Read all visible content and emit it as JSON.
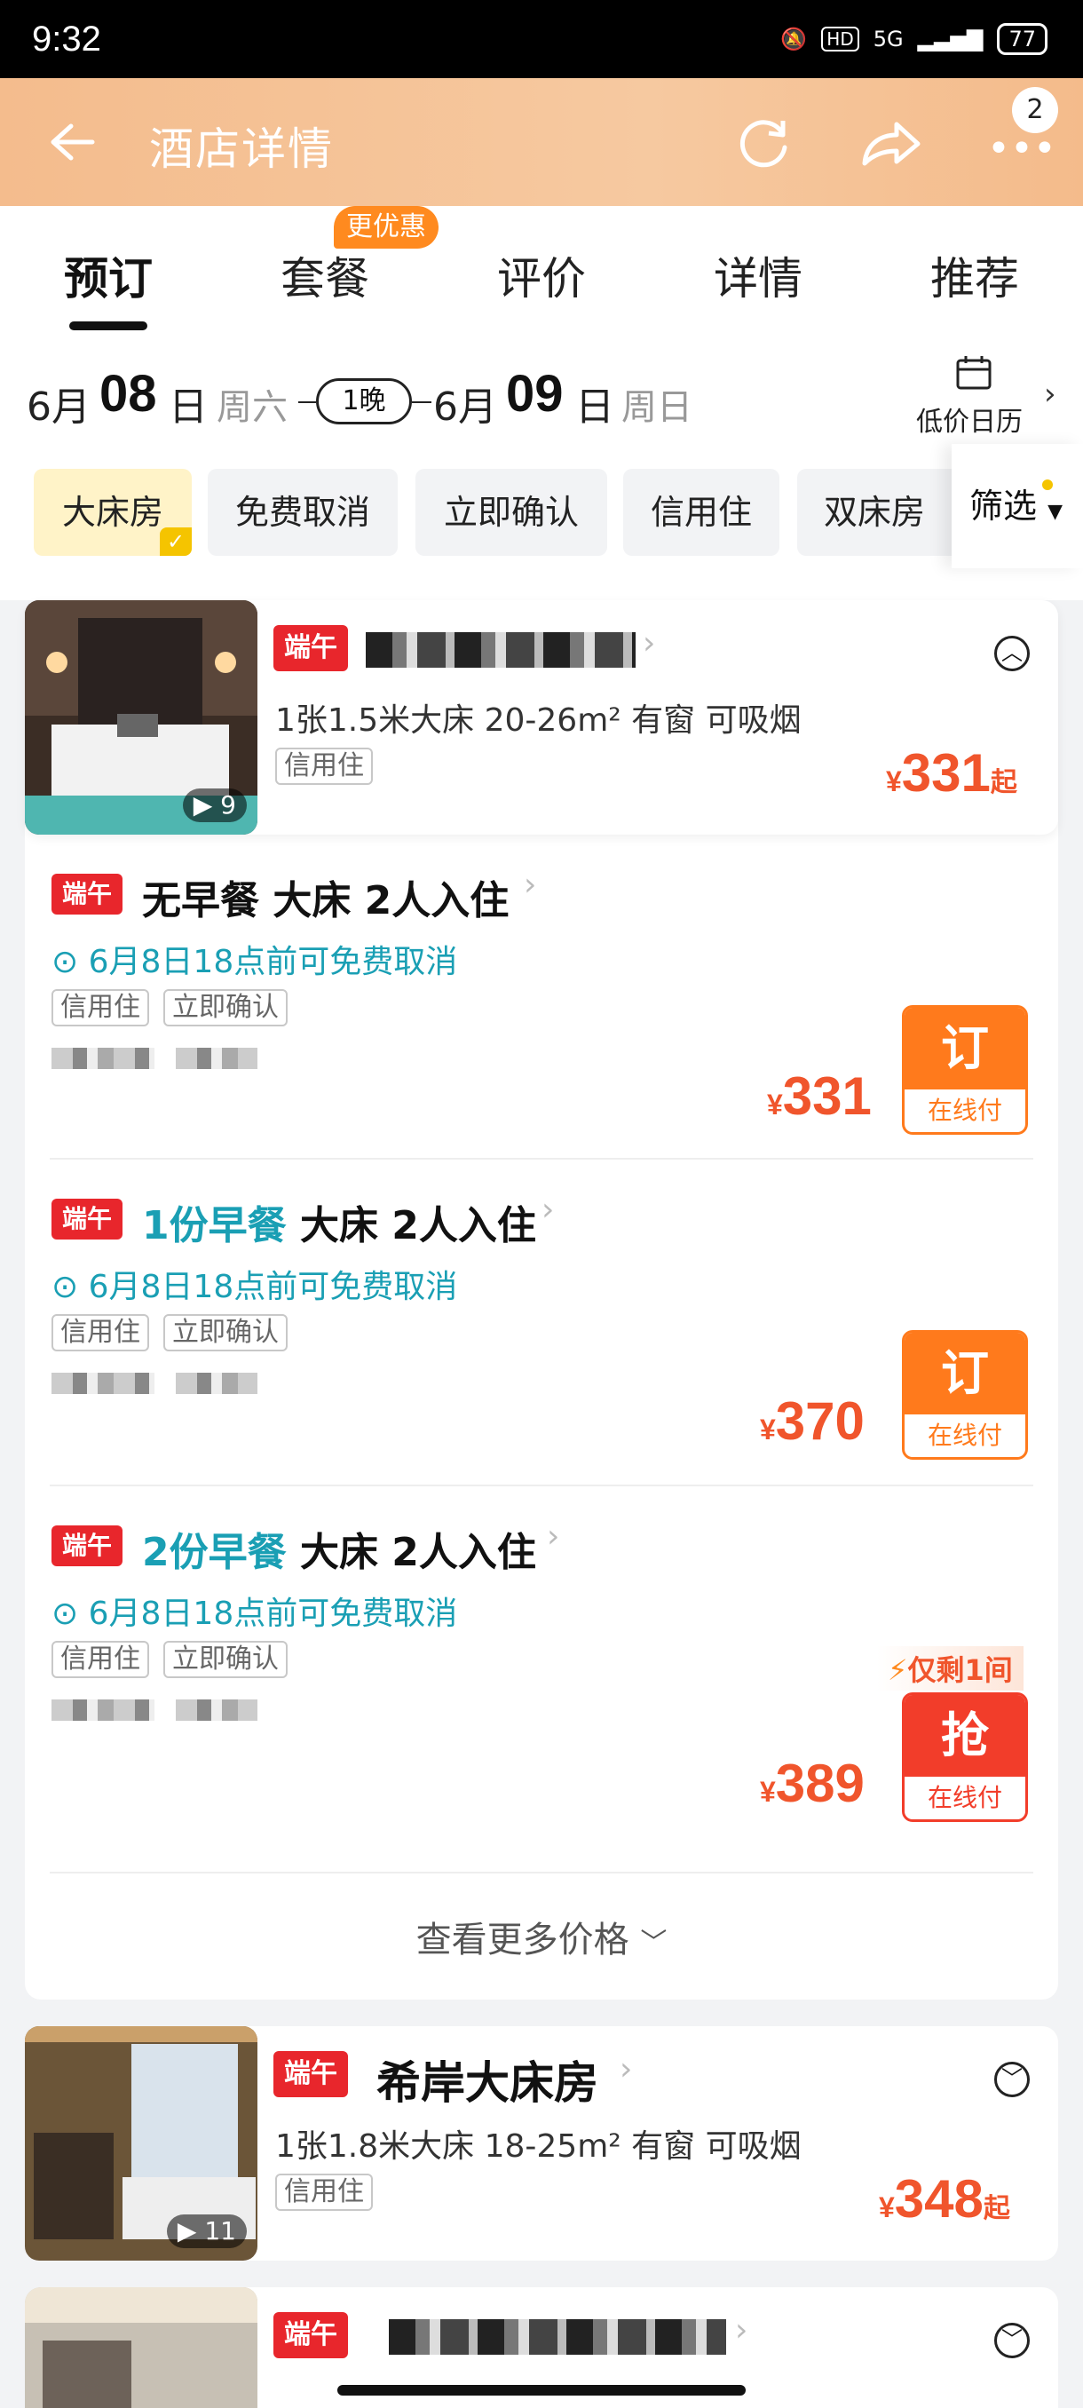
{
  "status_bar": {
    "time": "9:32",
    "net": "5G",
    "hd": "HD",
    "battery": "77"
  },
  "app_bar": {
    "title": "酒店详情",
    "badge": "2"
  },
  "tabs": {
    "promo": "更优惠",
    "items": [
      {
        "label": "预订"
      },
      {
        "label": "套餐"
      },
      {
        "label": "评价"
      },
      {
        "label": "详情"
      },
      {
        "label": "推荐"
      }
    ]
  },
  "dates": {
    "checkin_month": "6月",
    "checkin_day": "08",
    "day_unit": "日",
    "checkin_week": "周六",
    "nights": "1晚",
    "checkout_month": "6月",
    "checkout_day": "09",
    "checkout_week": "周日",
    "calendar_label": "低价日历"
  },
  "filters": {
    "chips": [
      "大床房",
      "免费取消",
      "立即确认",
      "信用住",
      "双床房"
    ],
    "filter_label": "筛选"
  },
  "rooms": [
    {
      "tag": "端午",
      "spec": "1张1.5米大床   20-26m²   有窗   可吸烟",
      "badge": "信用住",
      "price": "331",
      "suffix": "起",
      "img_count": "9"
    },
    {
      "tag": "端午",
      "name": "希岸大床房",
      "spec": "1张1.8米大床   18-25m²   有窗   可吸烟",
      "badge": "信用住",
      "price": "348",
      "suffix": "起",
      "img_count": "11"
    },
    {
      "tag": "端午"
    }
  ],
  "plans": [
    {
      "tag": "端午",
      "breakfast": "无早餐",
      "rest": " 大床 2人入住",
      "cancel": "6月8日18点前可免费取消",
      "badges": [
        "信用住",
        "立即确认"
      ],
      "price": "331",
      "btn": "订",
      "pay": "在线付"
    },
    {
      "tag": "端午",
      "breakfast": "1份早餐",
      "rest": " 大床 2人入住",
      "cancel": "6月8日18点前可免费取消",
      "badges": [
        "信用住",
        "立即确认"
      ],
      "price": "370",
      "btn": "订",
      "pay": "在线付"
    },
    {
      "tag": "端午",
      "breakfast": "2份早餐",
      "rest": " 大床 2人入住",
      "cancel": "6月8日18点前可免费取消",
      "badges": [
        "信用住",
        "立即确认"
      ],
      "price": "389",
      "btn": "抢",
      "pay": "在线付",
      "hint": "仅剩1间"
    }
  ],
  "currency": "¥",
  "more_prices": "查看更多价格"
}
